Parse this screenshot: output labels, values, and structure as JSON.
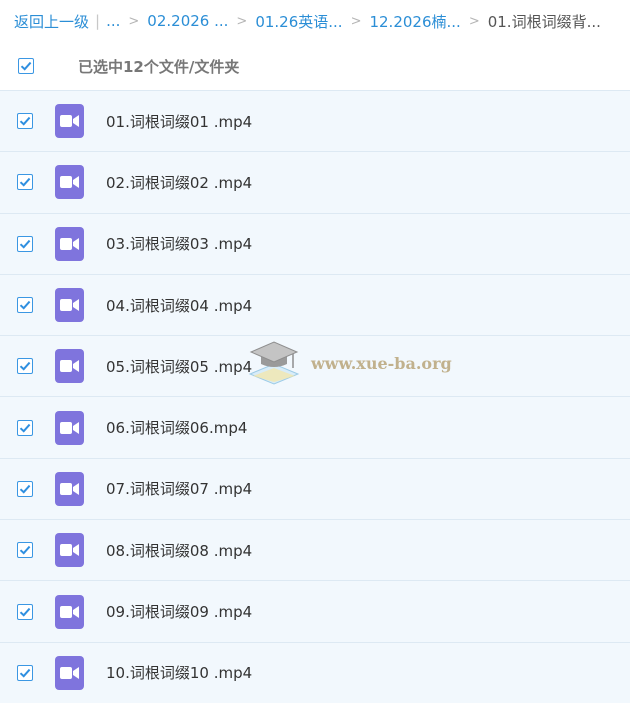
{
  "breadcrumb": {
    "back": "返回上一级",
    "ellipsis": "...",
    "crumbs": [
      "02.2026 ...",
      "01.26英语...",
      "12.2026楠..."
    ],
    "current": "01.词根词缀背..."
  },
  "selection": {
    "text": "已选中12个文件/文件夹",
    "checked": true
  },
  "files": [
    {
      "name": "01.词根词缀01 .mp4",
      "checked": true
    },
    {
      "name": "02.词根词缀02 .mp4",
      "checked": true
    },
    {
      "name": "03.词根词缀03 .mp4",
      "checked": true
    },
    {
      "name": "04.词根词缀04 .mp4",
      "checked": true
    },
    {
      "name": "05.词根词缀05 .mp4",
      "checked": true
    },
    {
      "name": "06.词根词缀06.mp4",
      "checked": true
    },
    {
      "name": "07.词根词缀07 .mp4",
      "checked": true
    },
    {
      "name": "08.词根词缀08 .mp4",
      "checked": true
    },
    {
      "name": "09.词根词缀09 .mp4",
      "checked": true
    },
    {
      "name": "10.词根词缀10 .mp4",
      "checked": true
    }
  ],
  "watermark": {
    "text": "www.xue-ba.org"
  },
  "colors": {
    "link": "#2b8ed6",
    "row_bg": "#f2f8fd",
    "file_icon": "#7f74dd",
    "check": "#3b97e3"
  },
  "icons": {
    "file": "video-file-icon",
    "check": "checkbox-checked-icon",
    "watermark": "graduation-cap-icon"
  }
}
